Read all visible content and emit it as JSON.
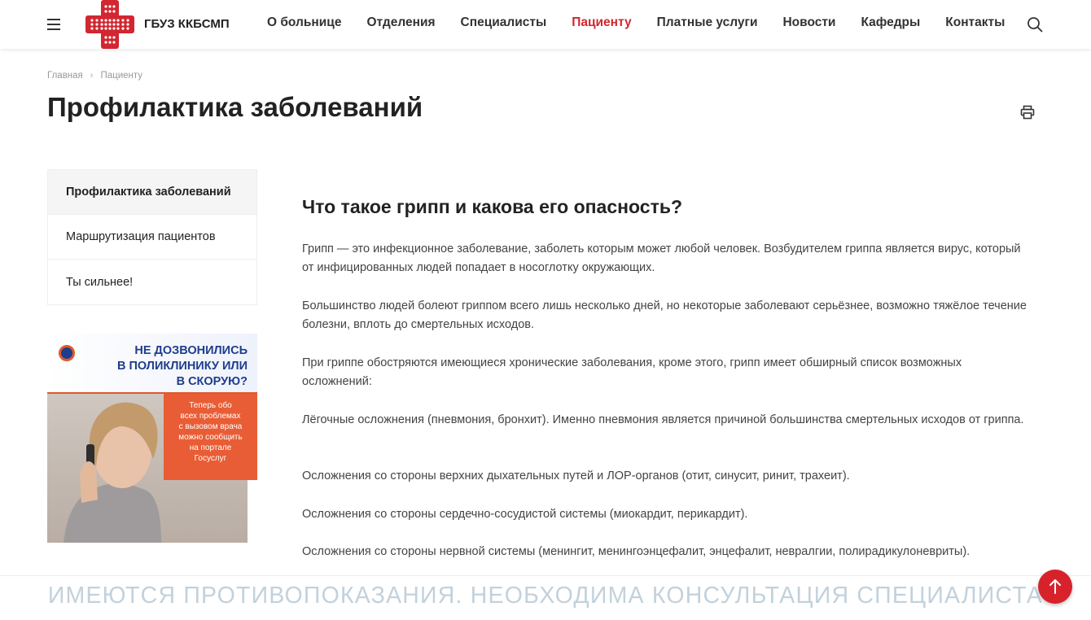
{
  "header": {
    "brand": "ГБУЗ ККБСМП",
    "nav": [
      {
        "label": "О больнице"
      },
      {
        "label": "Отделения"
      },
      {
        "label": "Специалисты"
      },
      {
        "label": "Пациенту",
        "active": true
      },
      {
        "label": "Платные услуги"
      },
      {
        "label": "Новости"
      },
      {
        "label": "Кафедры"
      },
      {
        "label": "Контакты"
      }
    ]
  },
  "breadcrumb": {
    "home": "Главная",
    "current": "Пациенту"
  },
  "page": {
    "title": "Профилактика заболеваний"
  },
  "sidebar": {
    "items": [
      {
        "label": "Профилактика заболеваний",
        "active": true
      },
      {
        "label": "Маршрутизация пациентов"
      },
      {
        "label": "Ты сильнее!"
      }
    ]
  },
  "banner": {
    "headline_1": "НЕ ДОЗВОНИЛИСЬ",
    "headline_2": "В ПОЛИКЛИНИКУ ИЛИ",
    "headline_3": "В СКОРУЮ?",
    "text_1": "Теперь обо",
    "text_2": "всех проблемах",
    "text_3": "с вызовом врача",
    "text_4": "можно сообщить",
    "text_5": "на портале",
    "text_6": "Госуслуг"
  },
  "content": {
    "heading": "Что такое грипп и какова его опасность?",
    "paragraphs": [
      "Грипп — это инфекционное заболевание, заболеть которым может любой человек. Возбудителем гриппа является вирус, который от инфицированных людей попадает в носоглотку окружающих.",
      "Большинство людей болеют гриппом всего лишь несколько дней, но некоторые заболевают серьёзнее, возможно тяжёлое течение болезни, вплоть до смертельных исходов.",
      "При гриппе обостряются имеющиеся хронические заболевания, кроме этого, грипп имеет обширный список возможных осложнений:",
      "Лёгочные осложнения (пневмония, бронхит). Именно пневмония является причиной большинства смертельных исходов от гриппа.",
      "Осложнения со стороны верхних дыхательных путей и ЛОР-органов (отит, синусит, ринит, трахеит).",
      "Осложнения со стороны сердечно-сосудистой системы (миокардит, перикардит).",
      "Осложнения со стороны нервной системы (менингит, менингоэнцефалит, энцефалит, невралгии, полирадикулоневриты)."
    ]
  },
  "footer": {
    "warning": "ИМЕЮТСЯ ПРОТИВОПОКАЗАНИЯ. НЕОБХОДИМА КОНСУЛЬТАЦИЯ СПЕЦИАЛИСТА"
  },
  "colors": {
    "accent": "#d22630",
    "banner_orange": "#e85d35",
    "banner_blue": "#1f3d8c",
    "warning_text": "#c2d1dc"
  },
  "icons": {
    "menu": "hamburger-icon",
    "search": "search-icon",
    "print": "printer-icon",
    "scroll_up": "arrow-up-icon"
  }
}
